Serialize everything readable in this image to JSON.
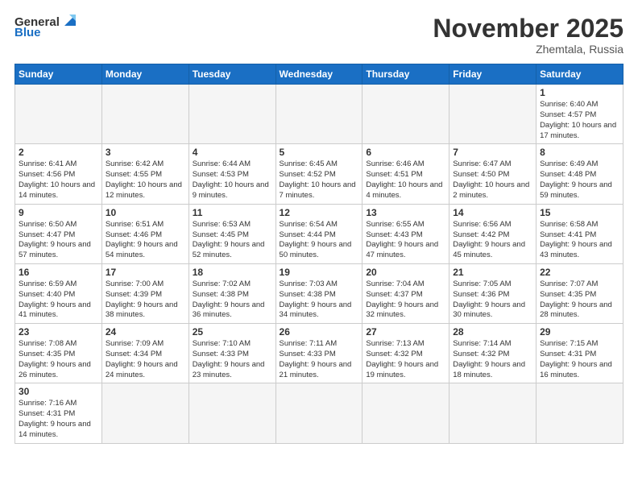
{
  "header": {
    "logo_general": "General",
    "logo_blue": "Blue",
    "month": "November 2025",
    "location": "Zhemtala, Russia"
  },
  "weekdays": [
    "Sunday",
    "Monday",
    "Tuesday",
    "Wednesday",
    "Thursday",
    "Friday",
    "Saturday"
  ],
  "weeks": [
    [
      {
        "day": "",
        "info": ""
      },
      {
        "day": "",
        "info": ""
      },
      {
        "day": "",
        "info": ""
      },
      {
        "day": "",
        "info": ""
      },
      {
        "day": "",
        "info": ""
      },
      {
        "day": "",
        "info": ""
      },
      {
        "day": "1",
        "info": "Sunrise: 6:40 AM\nSunset: 4:57 PM\nDaylight: 10 hours and 17 minutes."
      }
    ],
    [
      {
        "day": "2",
        "info": "Sunrise: 6:41 AM\nSunset: 4:56 PM\nDaylight: 10 hours and 14 minutes."
      },
      {
        "day": "3",
        "info": "Sunrise: 6:42 AM\nSunset: 4:55 PM\nDaylight: 10 hours and 12 minutes."
      },
      {
        "day": "4",
        "info": "Sunrise: 6:44 AM\nSunset: 4:53 PM\nDaylight: 10 hours and 9 minutes."
      },
      {
        "day": "5",
        "info": "Sunrise: 6:45 AM\nSunset: 4:52 PM\nDaylight: 10 hours and 7 minutes."
      },
      {
        "day": "6",
        "info": "Sunrise: 6:46 AM\nSunset: 4:51 PM\nDaylight: 10 hours and 4 minutes."
      },
      {
        "day": "7",
        "info": "Sunrise: 6:47 AM\nSunset: 4:50 PM\nDaylight: 10 hours and 2 minutes."
      },
      {
        "day": "8",
        "info": "Sunrise: 6:49 AM\nSunset: 4:48 PM\nDaylight: 9 hours and 59 minutes."
      }
    ],
    [
      {
        "day": "9",
        "info": "Sunrise: 6:50 AM\nSunset: 4:47 PM\nDaylight: 9 hours and 57 minutes."
      },
      {
        "day": "10",
        "info": "Sunrise: 6:51 AM\nSunset: 4:46 PM\nDaylight: 9 hours and 54 minutes."
      },
      {
        "day": "11",
        "info": "Sunrise: 6:53 AM\nSunset: 4:45 PM\nDaylight: 9 hours and 52 minutes."
      },
      {
        "day": "12",
        "info": "Sunrise: 6:54 AM\nSunset: 4:44 PM\nDaylight: 9 hours and 50 minutes."
      },
      {
        "day": "13",
        "info": "Sunrise: 6:55 AM\nSunset: 4:43 PM\nDaylight: 9 hours and 47 minutes."
      },
      {
        "day": "14",
        "info": "Sunrise: 6:56 AM\nSunset: 4:42 PM\nDaylight: 9 hours and 45 minutes."
      },
      {
        "day": "15",
        "info": "Sunrise: 6:58 AM\nSunset: 4:41 PM\nDaylight: 9 hours and 43 minutes."
      }
    ],
    [
      {
        "day": "16",
        "info": "Sunrise: 6:59 AM\nSunset: 4:40 PM\nDaylight: 9 hours and 41 minutes."
      },
      {
        "day": "17",
        "info": "Sunrise: 7:00 AM\nSunset: 4:39 PM\nDaylight: 9 hours and 38 minutes."
      },
      {
        "day": "18",
        "info": "Sunrise: 7:02 AM\nSunset: 4:38 PM\nDaylight: 9 hours and 36 minutes."
      },
      {
        "day": "19",
        "info": "Sunrise: 7:03 AM\nSunset: 4:38 PM\nDaylight: 9 hours and 34 minutes."
      },
      {
        "day": "20",
        "info": "Sunrise: 7:04 AM\nSunset: 4:37 PM\nDaylight: 9 hours and 32 minutes."
      },
      {
        "day": "21",
        "info": "Sunrise: 7:05 AM\nSunset: 4:36 PM\nDaylight: 9 hours and 30 minutes."
      },
      {
        "day": "22",
        "info": "Sunrise: 7:07 AM\nSunset: 4:35 PM\nDaylight: 9 hours and 28 minutes."
      }
    ],
    [
      {
        "day": "23",
        "info": "Sunrise: 7:08 AM\nSunset: 4:35 PM\nDaylight: 9 hours and 26 minutes."
      },
      {
        "day": "24",
        "info": "Sunrise: 7:09 AM\nSunset: 4:34 PM\nDaylight: 9 hours and 24 minutes."
      },
      {
        "day": "25",
        "info": "Sunrise: 7:10 AM\nSunset: 4:33 PM\nDaylight: 9 hours and 23 minutes."
      },
      {
        "day": "26",
        "info": "Sunrise: 7:11 AM\nSunset: 4:33 PM\nDaylight: 9 hours and 21 minutes."
      },
      {
        "day": "27",
        "info": "Sunrise: 7:13 AM\nSunset: 4:32 PM\nDaylight: 9 hours and 19 minutes."
      },
      {
        "day": "28",
        "info": "Sunrise: 7:14 AM\nSunset: 4:32 PM\nDaylight: 9 hours and 18 minutes."
      },
      {
        "day": "29",
        "info": "Sunrise: 7:15 AM\nSunset: 4:31 PM\nDaylight: 9 hours and 16 minutes."
      }
    ],
    [
      {
        "day": "30",
        "info": "Sunrise: 7:16 AM\nSunset: 4:31 PM\nDaylight: 9 hours and 14 minutes."
      },
      {
        "day": "",
        "info": ""
      },
      {
        "day": "",
        "info": ""
      },
      {
        "day": "",
        "info": ""
      },
      {
        "day": "",
        "info": ""
      },
      {
        "day": "",
        "info": ""
      },
      {
        "day": "",
        "info": ""
      }
    ]
  ]
}
